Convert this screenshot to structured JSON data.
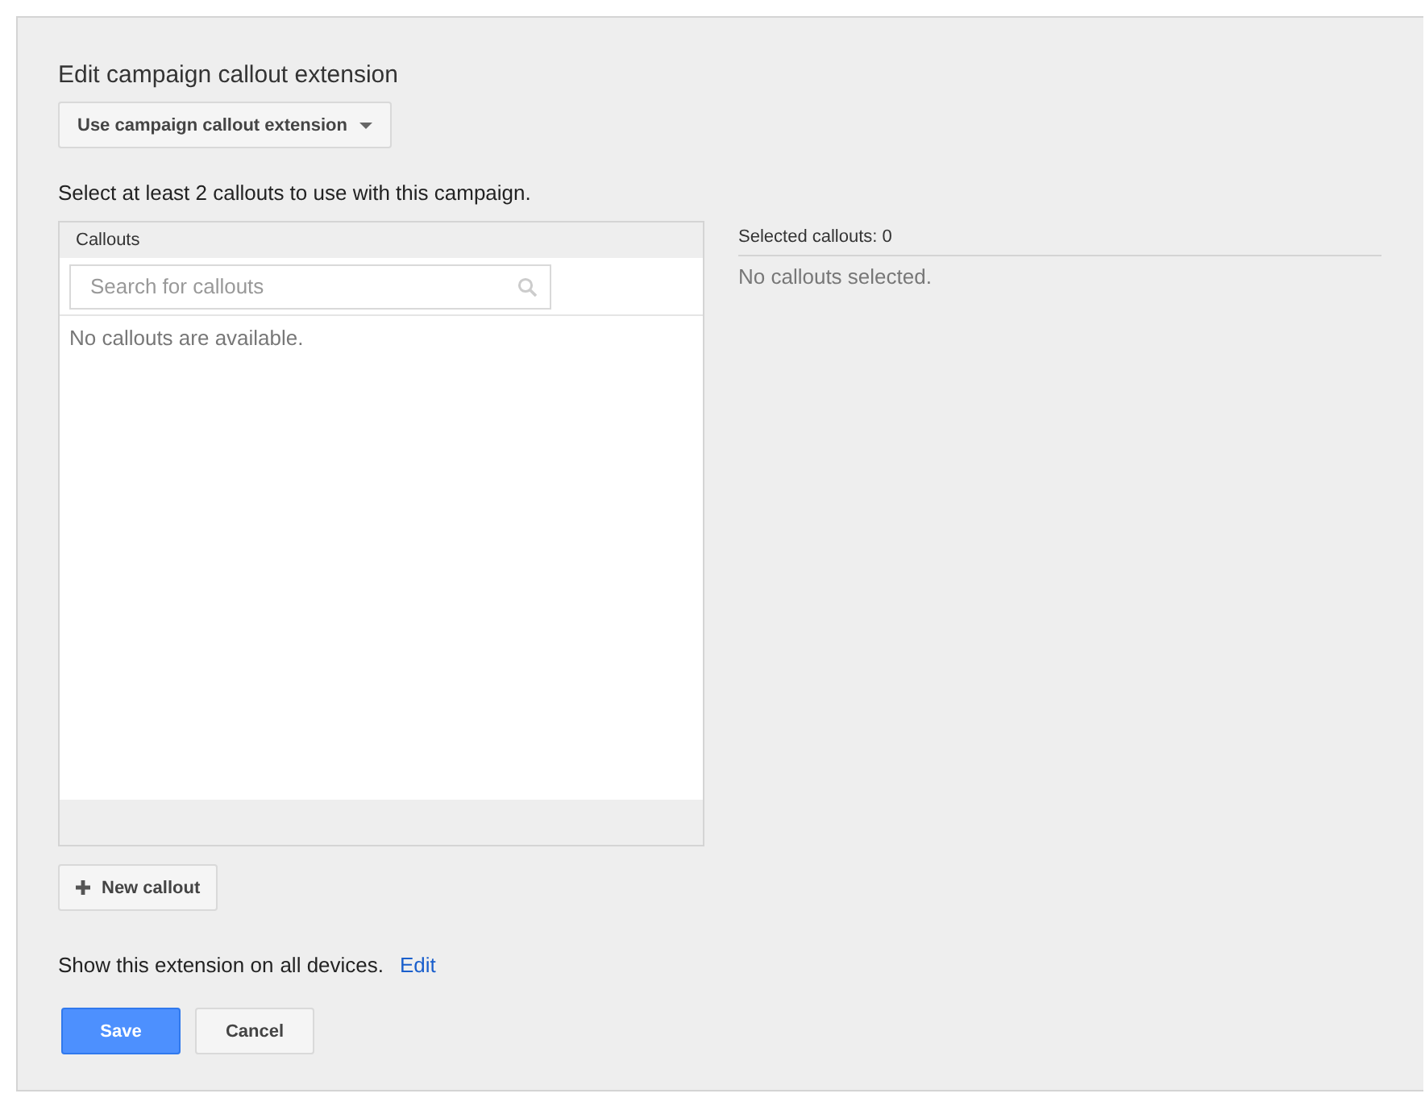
{
  "title": "Edit campaign callout extension",
  "mode_dropdown": {
    "label": "Use campaign callout extension"
  },
  "instruction": "Select at least 2 callouts to use with this campaign.",
  "callouts_panel": {
    "header": "Callouts",
    "search": {
      "placeholder": "Search for callouts"
    },
    "empty_text": "No callouts are available."
  },
  "selected_panel": {
    "header": "Selected callouts: 0",
    "empty_text": "No callouts selected."
  },
  "new_callout_button": {
    "label": "New callout"
  },
  "devices": {
    "text": "Show this extension on",
    "value": "all devices.",
    "link": "Edit"
  },
  "buttons": [
    {
      "label": "Save",
      "kind": "primary"
    },
    {
      "label": "Cancel",
      "kind": "secondary"
    }
  ]
}
